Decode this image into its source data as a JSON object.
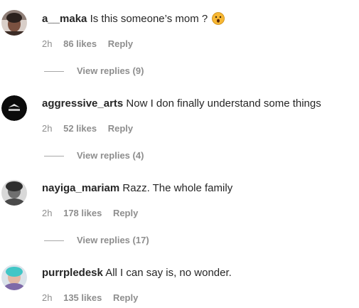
{
  "comments": [
    {
      "username": "a__maka",
      "text": "Is this someone’s mom ?",
      "emoji": "astonished-face-emoji",
      "time": "2h",
      "likes": "86 likes",
      "reply": "Reply",
      "view_replies": "View replies (9)"
    },
    {
      "username": "aggressive_arts",
      "text": "Now I don finally understand some things",
      "time": "2h",
      "likes": "52 likes",
      "reply": "Reply",
      "view_replies": "View replies (4)"
    },
    {
      "username": "nayiga_mariam",
      "text": "Razz. The whole family",
      "time": "2h",
      "likes": "178 likes",
      "reply": "Reply",
      "view_replies": "View replies (17)"
    },
    {
      "username": "purrpledesk",
      "text": "All I can say is, no wonder.",
      "time": "2h",
      "likes": "135 likes",
      "reply": "Reply"
    }
  ],
  "colors": {
    "text": "#262626",
    "muted": "#8e8e8e",
    "emoji_face": "#f7b733"
  }
}
